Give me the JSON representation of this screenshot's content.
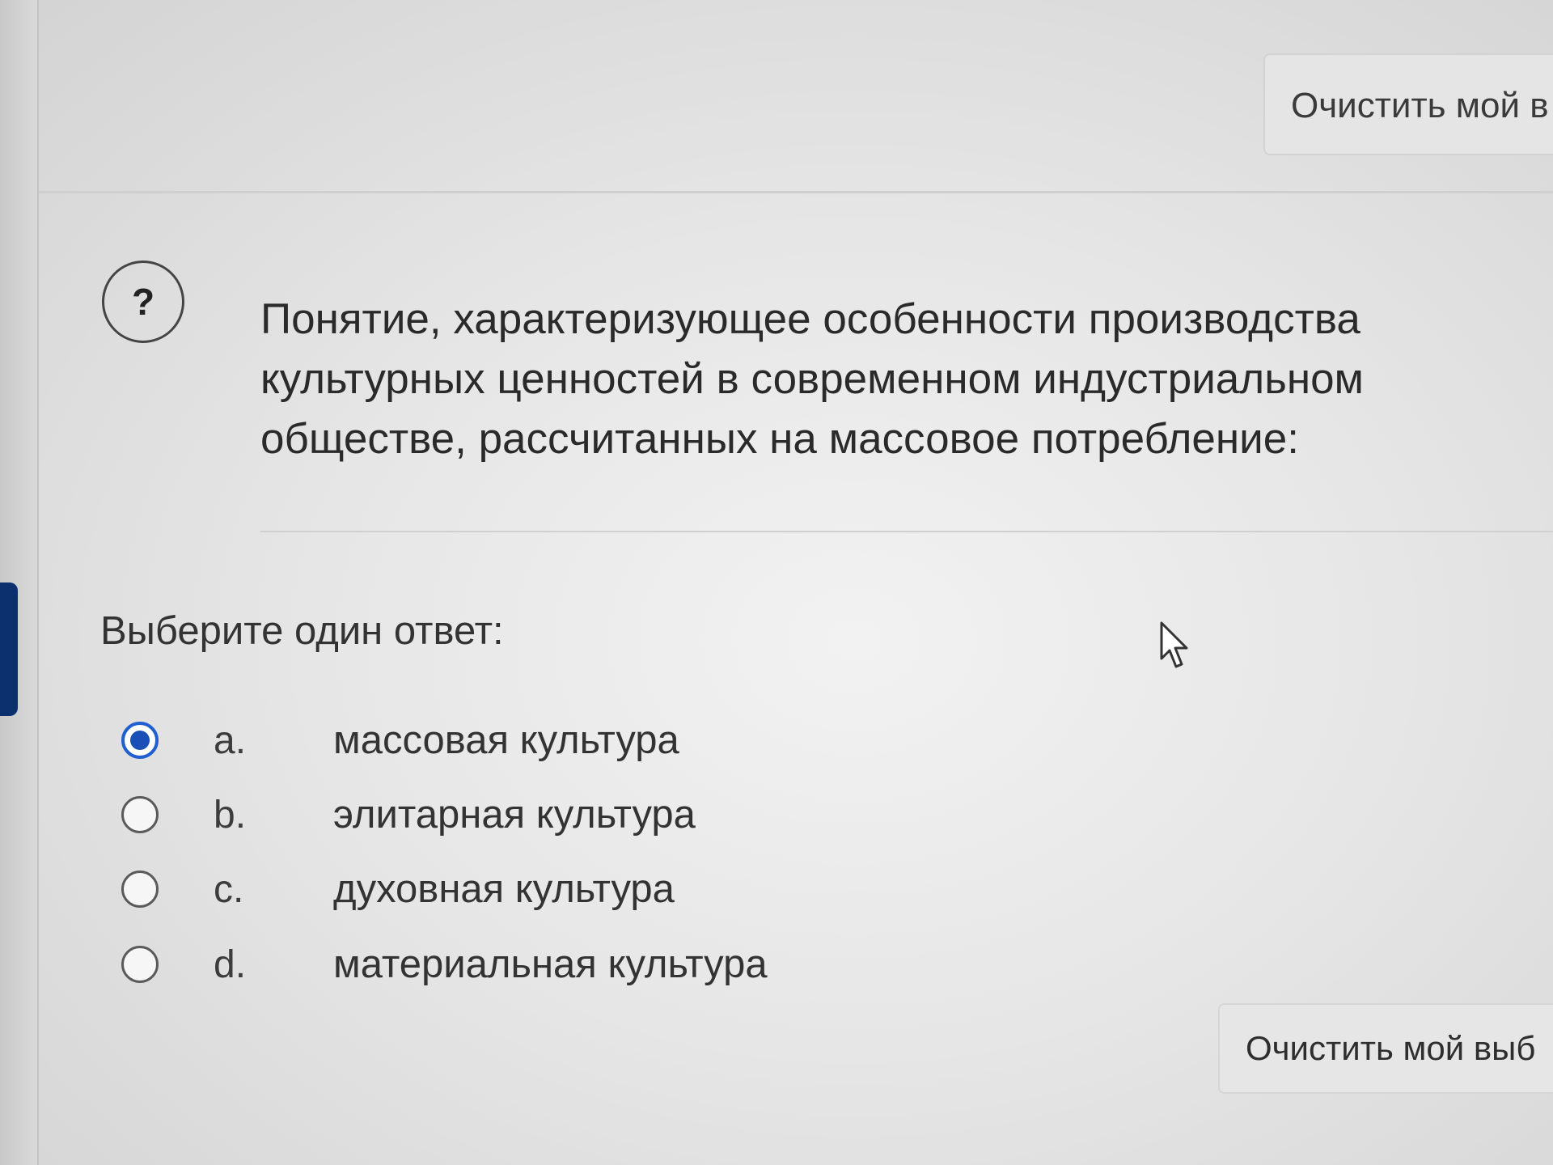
{
  "top_button": {
    "label": "Очистить мой в"
  },
  "question": {
    "icon_symbol": "?",
    "lines": [
      "Понятие, характеризующее особенности производства",
      "культурных ценностей в современном индустриальном",
      "обществе, рассчитанных на массовое потребление:"
    ]
  },
  "prompt": "Выберите один ответ:",
  "options": [
    {
      "letter": "a.",
      "text": "массовая культура",
      "checked": true
    },
    {
      "letter": "b.",
      "text": "элитарная культура",
      "checked": false
    },
    {
      "letter": "c.",
      "text": "духовная культура",
      "checked": false
    },
    {
      "letter": "d.",
      "text": "материальная культура",
      "checked": false
    }
  ],
  "bottom_button": {
    "label": "Очистить мой выб"
  },
  "colors": {
    "accent": "#1a4fb8",
    "nav_tab": "#0c2f6e"
  },
  "icons": {
    "question": "question-mark-icon",
    "cursor": "mouse-pointer-icon"
  }
}
